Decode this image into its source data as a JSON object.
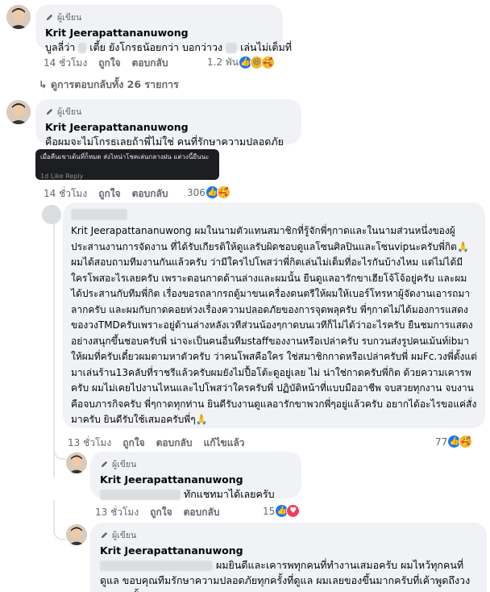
{
  "badge_label": "ผู้เขียน",
  "comments": [
    {
      "author": "Krit Jeerapattananuwong",
      "text_a": "บูลลี่ว่า",
      "text_b": "เตี้ย ยังโกรธน้อยกว่า บอกว่าวง",
      "text_c": "เล่นไม่เต็มที่",
      "time": "14 ชั่วโมง",
      "like": "ถูกใจ",
      "reply": "ตอบกลับ",
      "reaction_count": "1.2 พัน"
    },
    {
      "author": "Krit Jeerapattananuwong",
      "text": "คือผมจะไม่โกรธเลยถ้าพี่ไม่ใช่ คนที่รักษาความปลอดภัย",
      "time": "14 ชั่วโมง",
      "like": "ถูกใจ",
      "reply": "ตอบกลับ",
      "reaction_count": "306",
      "screenshot_text": "เมื่อคืนเขาเต้นที่ก็หมด ส่งไหน่าโชคเล่นกลางฝน แต่วงนี้ยืนนะ",
      "screenshot_meta": "1d   Like   Reply"
    },
    {
      "text": "Krit Jeerapattananuwong ผมในนามตัวแทนสมาชิกที่รู้จักพี่ๆกาดและในนามส่วนหนึ่งของผู้ประสานงานการจัดงาน ที่ได้รับเกียรติให้ดูแลรับผิดชอบดูแลโซนศิลปินและโซนvipนะครับพี่กิต🙏 ผมได้สอบถามทีมงานกันแล้วครับ ว่ามีใครไปโพสว่าพี่กิตเล่นไม่เต็มที่อะไรกันบ้างไหม แต่ไม่ได้มีใครโพสอะไรเลยครับ เพราะตอนกาดด้านล่างและผมนั้น ยืนดูแลอารักขาเฮียโจ้โจ้อยู่ครับ และผมได้ประสานกับทีมพี่กิต เรื่องขอรถลากรถตู้มาขนเครื่องดนตรีให้ผมให้เบอร์โทรหาผู้จัดงานเอารถมาลากครับ และผมกับกาดคอยห่วงเรื่องความปลอดภัยของการจุดพลุครับ พี่ๆกาดไม่ได้มองการแสดงของวงTMDครับเพราะอยู่ด้านล่างหลังเวทีส่วนน้องๆกาดบนเวทีก็ไม่ได้ว่าอะไรครับ ยืนชมการแสดงอย่างสนุกขึ้นชอบครับพี่ น่าจะเป็นคนอื่นทีมstaffของงานหรือเปล่าครับ รบกวนส่งรูปคนเม้นท์ibมาให้ผมที่ครับเดี๋ยวผมตามหาตัวครับ ว่าคนโพสคือใคร ใช่สมาชิกกาดหรือเปล่าครับพี่ ผมFc.วงพี่ตั้งแต่มาเล่นร้าน13คลับที่ราชรีแล้วครับผมยังไม่ปื้อโต้ะดูอยู่เลย ไม่ น่าใช่กาดครับพี่กิต ด้วยความเคารพครับ ผมไม่เคยไปงานไหนและไปโพสว่าใครครับพี่ ปฏิบัติหน้าที่แบบมืออาชีพ จบสวยทุกงาน จบงานคือจบภารกิจครับ พี่ๆกาดทุกท่าน ยินดีรับงานดูแลอารักขาพวกพี่ๆอยู่แล้วครับ อยากได้อะไรขอแค่สั่งมาครับ ยินดีรับใช้เสมอครับพี่ๆ🙏",
      "time": "13 ชั่วโมง",
      "like": "ถูกใจ",
      "reply": "ตอบกลับ",
      "edited": "แก้ไขแล้ว",
      "reaction_count": "77"
    },
    {
      "author": "Krit Jeerapattananuwong",
      "text": "ทักแชทมาได้เลยครับ",
      "time": "13 ชั่วโมง",
      "like": "ถูกใจ",
      "reply": "ตอบกลับ",
      "reaction_count": "15"
    },
    {
      "author": "Krit Jeerapattananuwong",
      "text": "ผมยินดีและเคารพทุกคนที่ทำงานเสมอครับ ผมไหว้ทุกคนที่ดูแล ขอบคุณทีมรักษาความปลอดภัยทุกครั้งที่ดูแล ผมเลยของขึ้นมากครับที่เค้าพูดถึงวงผมแบบนั้น"
    }
  ],
  "view_all_replies": "ดูการตอบกลับทั้ง 26 รายการ",
  "colors": {
    "bubble": "#f0f2f5",
    "secondary_text": "#65676b",
    "like_blue": "#1877f2",
    "love_red": "#f33e58",
    "haha_yellow": "#f7b928"
  }
}
